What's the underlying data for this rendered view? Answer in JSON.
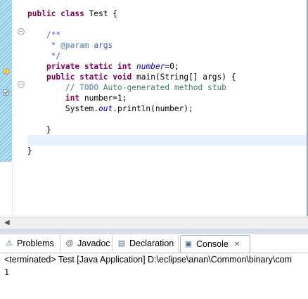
{
  "editor": {
    "lines": [
      {
        "parts": [
          {
            "t": "public",
            "c": "kw"
          },
          {
            "t": " "
          },
          {
            "t": "class",
            "c": "kw"
          },
          {
            "t": " Test {"
          }
        ]
      },
      {
        "parts": []
      },
      {
        "parts": [
          {
            "t": "    "
          },
          {
            "t": "/**",
            "c": "jd"
          }
        ]
      },
      {
        "parts": [
          {
            "t": "     * ",
            "c": "jd"
          },
          {
            "t": "@param",
            "c": "jdtag"
          },
          {
            "t": " args",
            "c": "jd"
          }
        ]
      },
      {
        "parts": [
          {
            "t": "     */",
            "c": "jd"
          }
        ]
      },
      {
        "parts": [
          {
            "t": "    "
          },
          {
            "t": "private",
            "c": "kw"
          },
          {
            "t": " "
          },
          {
            "t": "static",
            "c": "kw"
          },
          {
            "t": " "
          },
          {
            "t": "int",
            "c": "kw"
          },
          {
            "t": " "
          },
          {
            "t": "number",
            "c": "fieldit"
          },
          {
            "t": "=0;"
          }
        ]
      },
      {
        "parts": [
          {
            "t": "    "
          },
          {
            "t": "public",
            "c": "kw"
          },
          {
            "t": " "
          },
          {
            "t": "static",
            "c": "kw"
          },
          {
            "t": " "
          },
          {
            "t": "void",
            "c": "kw"
          },
          {
            "t": " main(String[] args) {"
          }
        ]
      },
      {
        "parts": [
          {
            "t": "        "
          },
          {
            "t": "// ",
            "c": "cm"
          },
          {
            "t": "TODO",
            "c": "tasktag"
          },
          {
            "t": " Auto-generated method stub",
            "c": "cm"
          }
        ]
      },
      {
        "parts": [
          {
            "t": "        "
          },
          {
            "t": "int",
            "c": "kw"
          },
          {
            "t": " number=1;"
          }
        ]
      },
      {
        "parts": [
          {
            "t": "        System."
          },
          {
            "t": "out",
            "c": "it"
          },
          {
            "t": ".println(number);"
          }
        ]
      },
      {
        "parts": []
      },
      {
        "parts": [
          {
            "t": "    }"
          }
        ]
      },
      {
        "parts": [],
        "highlight": true
      },
      {
        "parts": [
          {
            "t": "}"
          }
        ]
      }
    ]
  },
  "tabs": [
    {
      "label": "Problems",
      "icon": "problems-icon",
      "glyph": "⚠"
    },
    {
      "label": "Javadoc",
      "icon": "javadoc-icon",
      "glyph": "@"
    },
    {
      "label": "Declaration",
      "icon": "declaration-icon",
      "glyph": "▤"
    },
    {
      "label": "Console",
      "icon": "console-icon",
      "glyph": "▣",
      "active": true,
      "close": "✕"
    }
  ],
  "console": {
    "header": "<terminated> Test [Java Application] D:\\eclipse\\anan\\Common\\binary\\com",
    "output": "1"
  },
  "colors": {
    "keyword": "#7f0055",
    "javadoc": "#3f5fbf",
    "comment": "#3f7f5f",
    "field": "#0000c0",
    "ruler": "#8ccbe6"
  }
}
